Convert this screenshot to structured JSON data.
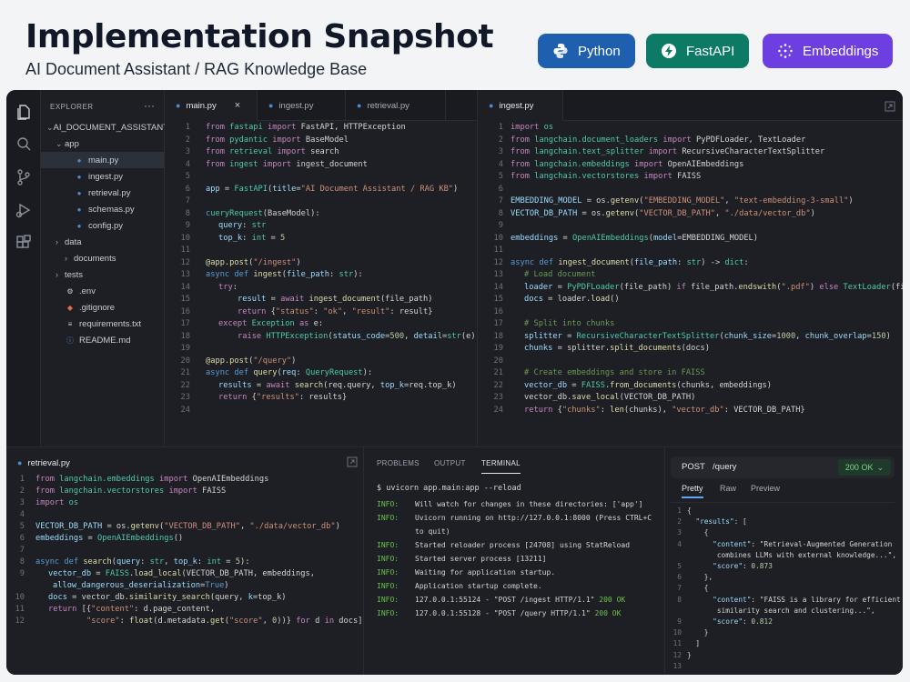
{
  "header": {
    "title": "Implementation Snapshot",
    "subtitle": "AI Document Assistant / RAG Knowledge Base",
    "badges": [
      {
        "label": "Python",
        "color": "#1f5fb0",
        "icon": "python-icon"
      },
      {
        "label": "FastAPI",
        "color": "#0d7a66",
        "icon": "bolt-icon"
      },
      {
        "label": "Embeddings",
        "color": "#6d3fe0",
        "icon": "sparkle-icon"
      }
    ]
  },
  "explorer": {
    "title": "EXPLORER",
    "more": "···",
    "items": [
      {
        "label": "AI_DOCUMENT_ASSISTANT",
        "depth": 0,
        "chevron": "⌄",
        "icon": ""
      },
      {
        "label": "app",
        "depth": 1,
        "chevron": "⌄",
        "icon": ""
      },
      {
        "label": "main.py",
        "depth": 2,
        "chevron": "",
        "icon": "python-file-icon",
        "active": true
      },
      {
        "label": "ingest.py",
        "depth": 2,
        "chevron": "",
        "icon": "python-file-icon"
      },
      {
        "label": "retrieval.py",
        "depth": 2,
        "chevron": "",
        "icon": "python-file-icon"
      },
      {
        "label": "schemas.py",
        "depth": 2,
        "chevron": "",
        "icon": "python-file-icon"
      },
      {
        "label": "config.py",
        "depth": 2,
        "chevron": "",
        "icon": "python-file-icon"
      },
      {
        "label": "data",
        "depth": 1,
        "chevron": "›",
        "icon": ""
      },
      {
        "label": "documents",
        "depth": 2,
        "chevron": "›",
        "icon": ""
      },
      {
        "label": "tests",
        "depth": 1,
        "chevron": "›",
        "icon": ""
      },
      {
        "label": ".env",
        "depth": 1,
        "chevron": "",
        "icon": "env-file-icon"
      },
      {
        "label": ".gitignore",
        "depth": 1,
        "chevron": "",
        "icon": "git-icon"
      },
      {
        "label": "requirements.txt",
        "depth": 1,
        "chevron": "",
        "icon": "text-file-icon"
      },
      {
        "label": "README.md",
        "depth": 1,
        "chevron": "",
        "icon": "info-icon"
      }
    ]
  },
  "editor_left": {
    "tabs": [
      {
        "label": "main.py",
        "active": true,
        "close": "×"
      },
      {
        "label": "ingest.py",
        "active": false
      },
      {
        "label": "retrieval.py",
        "active": false
      }
    ]
  },
  "editor_right": {
    "tabs": [
      {
        "label": "ingest.py",
        "active": true
      }
    ]
  },
  "editor_bottom": {
    "tabs": [
      {
        "label": "retrieval.py",
        "active": true
      }
    ]
  },
  "terminal": {
    "tabs": [
      {
        "label": "PROBLEMS",
        "active": false
      },
      {
        "label": "OUTPUT",
        "active": false
      },
      {
        "label": "TERMINAL",
        "active": true
      }
    ],
    "command": "$ uvicorn app.main:app --reload",
    "lines": [
      {
        "level": "INFO:",
        "text": "Will watch for changes in these directories: ['app']"
      },
      {
        "level": "INFO:",
        "text": "Uvicorn running on http://127.0.0.1:8000 (Press CTRL+C"
      },
      {
        "level": "",
        "text": "to quit)"
      },
      {
        "level": "INFO:",
        "text": "Started reloader process [24708] using StatReload"
      },
      {
        "level": "INFO:",
        "text": "Started server process [13211]"
      },
      {
        "level": "INFO:",
        "text": "Waiting for application startup."
      },
      {
        "level": "INFO:",
        "text": "Application startup complete."
      },
      {
        "level": "INFO:",
        "text": "127.0.0.1:55124 - \"POST /ingest HTTP/1.1\" ",
        "ok": "200 OK"
      },
      {
        "level": "INFO:",
        "text": "127.0.0.1:55128 - \"POST /query HTTP/1.1\" ",
        "ok": "200 OK"
      }
    ]
  },
  "api": {
    "method": "POST",
    "path": "/query",
    "status": "200 OK",
    "status_chevron": "⌄",
    "tabs": [
      {
        "label": "Pretty",
        "active": true
      },
      {
        "label": "Raw",
        "active": false
      },
      {
        "label": "Preview",
        "active": false
      }
    ],
    "response_lines": [
      "{",
      "  \"results\": [",
      "    {",
      "      \"content\": \"Retrieval-Augmented Generation",
      "       combines LLMs with external knowledge...\",",
      "      \"score\": 0.873",
      "    },",
      "    {",
      "      \"content\": \"FAISS is a library for efficient",
      "       similarity search and clustering...\",",
      "      \"score\": 0.812",
      "    }",
      "  ]",
      "}"
    ],
    "response_line_numbers": [
      "1",
      "2",
      "3",
      "4",
      "",
      "5",
      "6",
      "7",
      "8",
      "",
      "9",
      "10",
      "11",
      "12",
      "13"
    ]
  }
}
